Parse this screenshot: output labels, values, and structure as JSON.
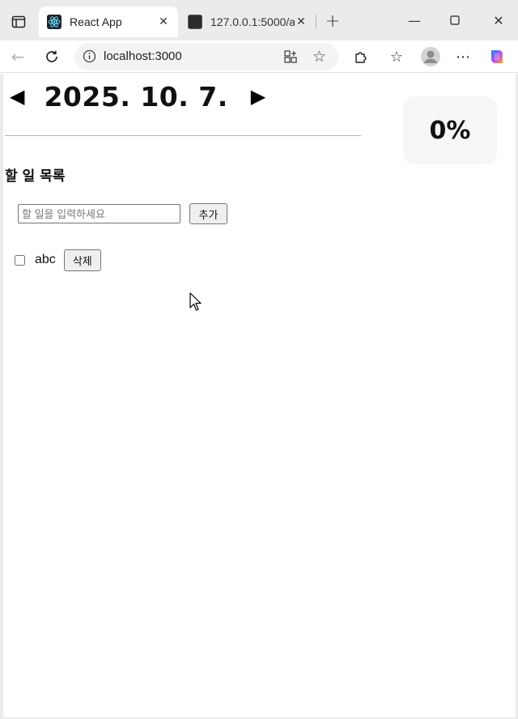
{
  "browser": {
    "tabs": [
      {
        "title": "React App",
        "active": true
      },
      {
        "title": "127.0.0.1:5000/a",
        "active": false
      }
    ],
    "address": "localhost:3000"
  },
  "app": {
    "date": "2025. 10. 7.",
    "prev_arrow": "◀",
    "next_arrow": "▶",
    "progress": "0%",
    "section_title": "할 일 목록",
    "input_placeholder": "할 일을 입력하세요",
    "input_value": "",
    "add_label": "추가",
    "todos": [
      {
        "text": "abc",
        "done": false,
        "delete_label": "삭제"
      }
    ]
  }
}
